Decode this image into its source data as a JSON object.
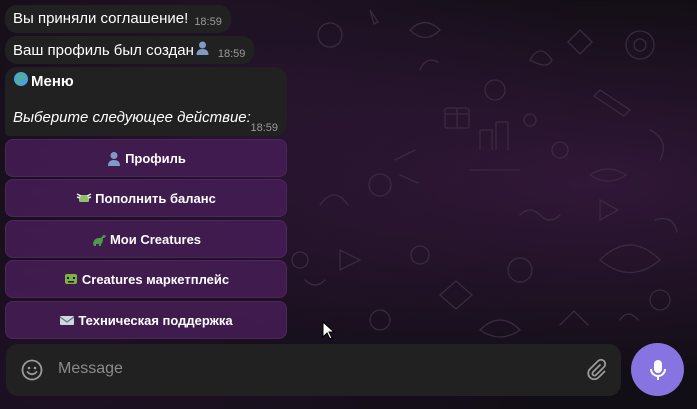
{
  "chat": {
    "messages": [
      {
        "text": "Вы приняли соглашение!",
        "time": "18:59"
      },
      {
        "text": "Ваш профиль был создан",
        "time": "18:59"
      }
    ],
    "menu_message": {
      "title": "Меню",
      "body": "Выберите следующее действие:",
      "time": "18:59"
    }
  },
  "keyboard": [
    {
      "label": "Профиль",
      "icon": "person-silhouette-icon"
    },
    {
      "label": "Пополнить баланс",
      "icon": "money-wings-icon"
    },
    {
      "label": "Мои Creatures",
      "icon": "dinosaur-icon"
    },
    {
      "label": "Creatures маркетплейс",
      "icon": "alien-monster-icon"
    },
    {
      "label": "Техническая поддержка",
      "icon": "envelope-icon"
    }
  ],
  "composer": {
    "placeholder": "Message",
    "emoji_icon": "smiley-icon",
    "attach_icon": "paperclip-icon",
    "send_icon": "microphone-icon"
  },
  "colors": {
    "bubble": "#212121",
    "keyboard_button": "#441c54",
    "accent": "#8774e1",
    "background": "#120e15"
  }
}
